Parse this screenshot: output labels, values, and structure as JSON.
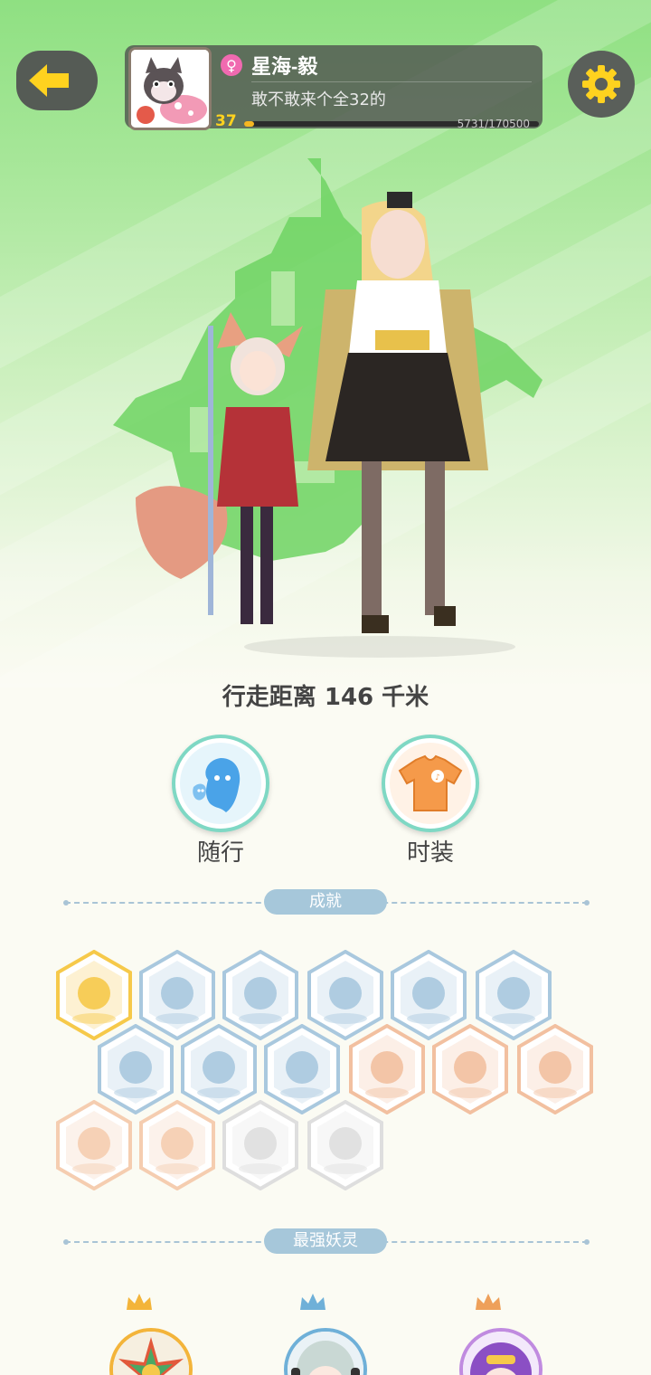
{
  "header": {
    "back_icon": "back-arrow-icon",
    "settings_icon": "gear-icon"
  },
  "profile": {
    "gender_symbol": "♀",
    "name": "星海-毅",
    "motto": "敢不敢来个全32的",
    "level": "37",
    "exp_text": "5731/170500",
    "exp_progress": 0.0336
  },
  "distance": {
    "text": "行走距离 146 千米"
  },
  "actions": [
    {
      "label": "随行",
      "icon": "companion-spirit-icon"
    },
    {
      "label": "时装",
      "icon": "fashion-shirt-icon"
    }
  ],
  "sections": {
    "achievements_title": "成就",
    "strongest_spirits_title": "最强妖灵"
  },
  "achievements": [
    {
      "icon": "orange-spirit-badge-icon",
      "color": "#f6c94a"
    },
    {
      "icon": "sneaker-badge-icon",
      "color": "#a9c8de"
    },
    {
      "icon": "lollipop-badge-icon",
      "color": "#a9c8de"
    },
    {
      "icon": "moon-badge-icon",
      "color": "#a9c8de"
    },
    {
      "icon": "crystal-ball-badge-icon",
      "color": "#a9c8de"
    },
    {
      "icon": "fire-spirit-badge-icon",
      "color": "#a9c8de"
    },
    {
      "icon": "stroller-cat-badge-icon",
      "color": "#a9c8de"
    },
    {
      "icon": "balloon-cat-badge-icon",
      "color": "#a9c8de"
    },
    {
      "icon": "yin-yang-book-badge-icon",
      "color": "#a9c8de"
    },
    {
      "icon": "egg-badge-icon",
      "color": "#f2c0a0"
    },
    {
      "icon": "yin-yang-swirl-badge-icon",
      "color": "#f2c0a0"
    },
    {
      "icon": "scroll-badge-icon",
      "color": "#f2c0a0"
    },
    {
      "icon": "demon-cat-badge-icon",
      "color": "#f5cdb0"
    },
    {
      "icon": "cat-pair-badge-icon",
      "color": "#f5cdb0"
    },
    {
      "icon": "dragon-locked-badge-icon",
      "color": "#dedede"
    },
    {
      "icon": "fox-book-locked-badge-icon",
      "color": "#dedede"
    }
  ],
  "strongest_spirits": [
    {
      "crown": "gold-crown-icon",
      "crown_color": "#f3b43a",
      "avatar": "spiky-spirit-avatar"
    },
    {
      "crown": "blue-crown-icon",
      "crown_color": "#6fb0d8",
      "avatar": "silver-hair-spirit-avatar"
    },
    {
      "crown": "bronze-crown-icon",
      "crown_color": "#eea05a",
      "avatar": "purple-hair-spirit-avatar"
    }
  ]
}
